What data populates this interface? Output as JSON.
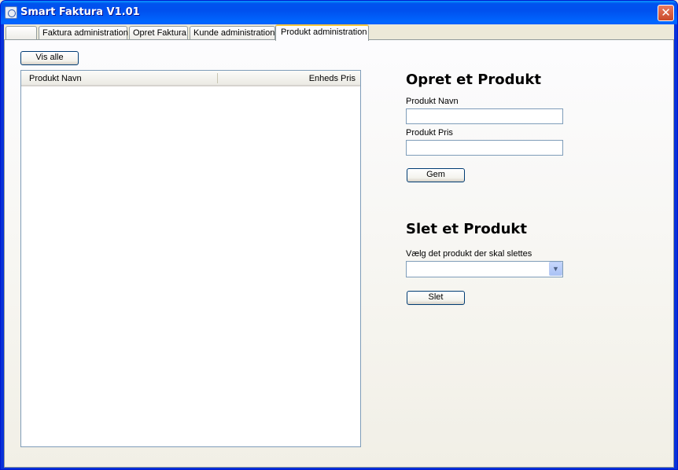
{
  "window": {
    "title": "Smart Faktura V1.01",
    "close_glyph": "✕"
  },
  "tabs": [
    {
      "label": ""
    },
    {
      "label": "Faktura administration"
    },
    {
      "label": "Opret Faktura"
    },
    {
      "label": "Kunde administration"
    },
    {
      "label": "Produkt administration",
      "selected": true
    }
  ],
  "left": {
    "show_all_button": "Vis alle",
    "list_columns": [
      "Produkt Navn",
      "Enheds Pris"
    ],
    "list_rows": []
  },
  "create_section": {
    "heading": "Opret et Produkt",
    "name_label": "Produkt Navn",
    "name_value": "",
    "price_label": "Produkt Pris",
    "price_value": "",
    "save_button": "Gem"
  },
  "delete_section": {
    "heading": "Slet et Produkt",
    "select_label": "Vælg det produkt der skal slettes",
    "selected_value": "",
    "delete_button": "Slet"
  },
  "icons": {
    "app": "app-icon",
    "close": "close-icon",
    "dropdown": "chevron-down-icon"
  }
}
